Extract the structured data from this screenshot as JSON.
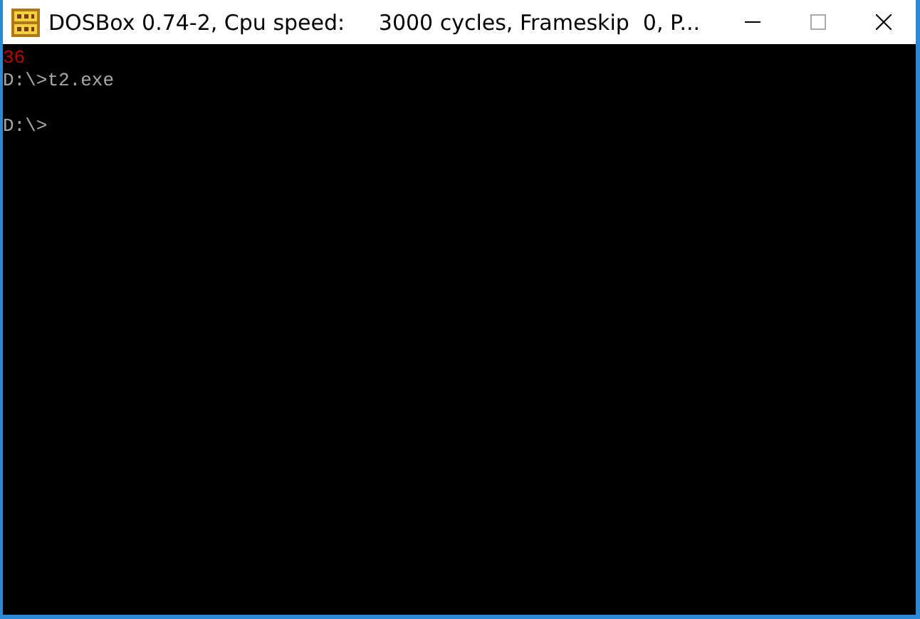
{
  "window": {
    "title": "DOSBox 0.74-2, Cpu speed:     3000 cycles, Frameskip  0, P..."
  },
  "console": {
    "blocks": [
      {
        "lines": [
          {
            "text": "36",
            "kind": "error"
          },
          {
            "text": "D:\\>t2.exe",
            "kind": "output"
          }
        ]
      },
      {
        "lines": [
          {
            "text": "D:\\>",
            "kind": "output"
          }
        ]
      }
    ]
  }
}
